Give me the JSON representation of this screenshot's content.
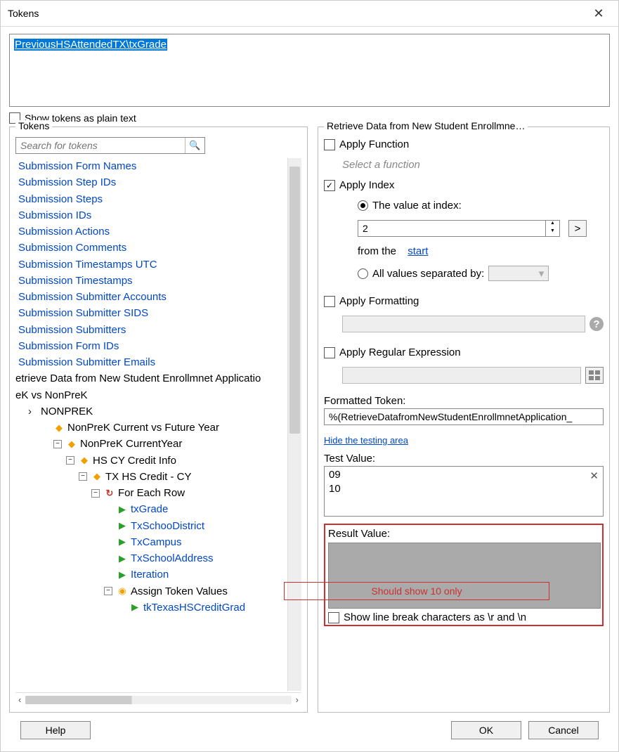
{
  "window": {
    "title": "Tokens"
  },
  "path_box": {
    "value": "PreviousHSAttendedTX\\txGrade"
  },
  "show_plain_text": {
    "label": "Show tokens as plain text",
    "checked": false
  },
  "tokens_panel": {
    "legend": "Tokens",
    "search_placeholder": "Search for tokens",
    "link_items": [
      "Submission Form Names",
      "Submission Step IDs",
      "Submission Steps",
      "Submission IDs",
      "Submission Actions",
      "Submission Comments",
      "Submission Timestamps UTC",
      "Submission Timestamps",
      "Submission Submitter Accounts",
      "Submission Submitter SIDS",
      "Submission Submitters",
      "Submission Form IDs",
      "Submission Submitter Emails"
    ],
    "plain_items": [
      "etrieve Data from New Student Enrollmnet Applicatio",
      "eK vs NonPreK"
    ],
    "tree": {
      "root_label": "NONPREK",
      "n1": "NonPreK Current vs Future Year",
      "n2": "NonPreK CurrentYear",
      "n3": "HS CY Credit Info",
      "n4": "TX HS Credit - CY",
      "n5": "For Each Row",
      "leaves": [
        "txGrade",
        "TxSchooDistrict",
        "TxCampus",
        "TxSchoolAddress",
        "Iteration"
      ],
      "n6": "Assign Token Values",
      "leaf6": "tkTexasHSCreditGrad"
    }
  },
  "retrieve_panel": {
    "legend": "Retrieve Data from New Student Enrollmne…",
    "apply_function": {
      "label": "Apply Function",
      "checked": false,
      "placeholder": "Select a function"
    },
    "apply_index": {
      "label": "Apply Index",
      "checked": true,
      "radio_value_at": {
        "label": "The value at index:",
        "checked": true,
        "value": "2",
        "from_label": "from the",
        "from_link": "start"
      },
      "radio_all_values": {
        "label": "All values separated by:",
        "checked": false
      }
    },
    "apply_formatting": {
      "label": "Apply Formatting",
      "checked": false
    },
    "apply_regex": {
      "label": "Apply Regular Expression",
      "checked": false
    },
    "formatted_token": {
      "label": "Formatted Token:",
      "value": "%(RetrieveDatafromNewStudentEnrollmnetApplication_"
    },
    "hide_testing": "Hide the testing area",
    "test_value": {
      "label": "Test Value:",
      "lines": [
        "09",
        "10"
      ]
    },
    "result_value": {
      "label": "Result Value:"
    },
    "annotation": "Should show 10 only",
    "show_line_breaks": {
      "label": "Show line break characters as \\r and \\n",
      "checked": false
    }
  },
  "buttons": {
    "help": "Help",
    "ok": "OK",
    "cancel": "Cancel"
  }
}
